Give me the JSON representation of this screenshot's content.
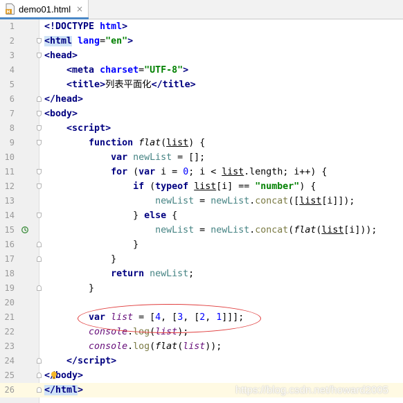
{
  "tab": {
    "title": "demo01.html",
    "close": "×",
    "file_icon": "html-file-icon"
  },
  "gutter_icons": {
    "line15": "override-marker-icon",
    "line25": "intention-bulb-icon"
  },
  "watermark": "https://blog.csdn.net/howard2005",
  "lines": [
    {
      "n": "1",
      "p": {
        "a": "<!DOCTYPE ",
        "b": "html",
        "c": ">"
      }
    },
    {
      "n": "2",
      "p": {
        "a": "<html",
        "b": " lang",
        "c": "=",
        "d": "\"en\"",
        "e": ">"
      }
    },
    {
      "n": "3",
      "p": {
        "a": "<head",
        "b": ">"
      }
    },
    {
      "n": "4",
      "p": {
        "i": "    ",
        "a": "<meta",
        "b": " charset",
        "c": "=",
        "d": "\"UTF-8\"",
        "e": ">"
      }
    },
    {
      "n": "5",
      "p": {
        "i": "    ",
        "a": "<title",
        "b": ">",
        "c": "列表平面化",
        "d": "</title",
        "e": ">"
      }
    },
    {
      "n": "6",
      "p": {
        "a": "</head",
        "b": ">"
      }
    },
    {
      "n": "7",
      "p": {
        "a": "<body",
        "b": ">"
      }
    },
    {
      "n": "8",
      "p": {
        "i": "    ",
        "a": "<script",
        "b": ">"
      }
    },
    {
      "n": "9",
      "p": {
        "i": "        ",
        "a": "function ",
        "b": "flat",
        "c": "(",
        "d": "list",
        "e": ") {"
      }
    },
    {
      "n": "10",
      "p": {
        "i": "            ",
        "a": "var ",
        "b": "newList",
        "c": " = [];"
      }
    },
    {
      "n": "11",
      "p": {
        "i": "            ",
        "a": "for ",
        "b": "(",
        "c": "var ",
        "d": "i = ",
        "e": "0",
        "f": "; i < ",
        "g": "list",
        "h": ".length; i++) {"
      }
    },
    {
      "n": "12",
      "p": {
        "i": "                ",
        "a": "if ",
        "b": "(",
        "c": "typeof ",
        "d": "list",
        "e": "[i] == ",
        "f": "\"number\"",
        "g": ") {"
      }
    },
    {
      "n": "13",
      "p": {
        "i": "                    ",
        "a": "newList",
        "b": " = ",
        "c": "newList",
        "d": ".",
        "e": "concat",
        "f": "([",
        "g": "list",
        "h": "[i]]);"
      }
    },
    {
      "n": "14",
      "p": {
        "i": "                ",
        "a": "} ",
        "b": "else ",
        "c": "{"
      }
    },
    {
      "n": "15",
      "p": {
        "i": "                    ",
        "a": "newList",
        "b": " = ",
        "c": "newList",
        "d": ".",
        "e": "concat",
        "f": "(",
        "g": "flat",
        "h": "(",
        "j": "list",
        "k": "[i]));"
      }
    },
    {
      "n": "16",
      "p": {
        "i": "                ",
        "a": "}"
      }
    },
    {
      "n": "17",
      "p": {
        "i": "            ",
        "a": "}"
      }
    },
    {
      "n": "18",
      "p": {
        "i": "            ",
        "a": "return ",
        "b": "newList",
        "c": ";"
      }
    },
    {
      "n": "19",
      "p": {
        "i": "        ",
        "a": "}"
      }
    },
    {
      "n": "20",
      "p": {}
    },
    {
      "n": "21",
      "p": {
        "i": "        ",
        "a": "var ",
        "b": "list",
        "c": " = [",
        "d": "4",
        ",": ", [",
        "e": "3",
        "f": ", [",
        "g": "2",
        "h": ", ",
        "j": "1",
        "k": "]]];"
      }
    },
    {
      "n": "22",
      "p": {
        "i": "        ",
        "a": "console",
        "b": ".",
        "c": "log",
        "d": "(",
        "e": "list",
        "f": ");"
      }
    },
    {
      "n": "23",
      "p": {
        "i": "        ",
        "a": "console",
        "b": ".",
        "c": "log",
        "d": "(",
        "e": "flat",
        "f": "(",
        "g": "list",
        "h": "));"
      }
    },
    {
      "n": "24",
      "p": {
        "i": "    ",
        "a": "</script",
        "b": ">"
      }
    },
    {
      "n": "25",
      "p": {
        "a": "</",
        "b": "body",
        "c": ">"
      }
    },
    {
      "n": "26",
      "p": {
        "a": "</html",
        "b": ">"
      }
    }
  ]
}
